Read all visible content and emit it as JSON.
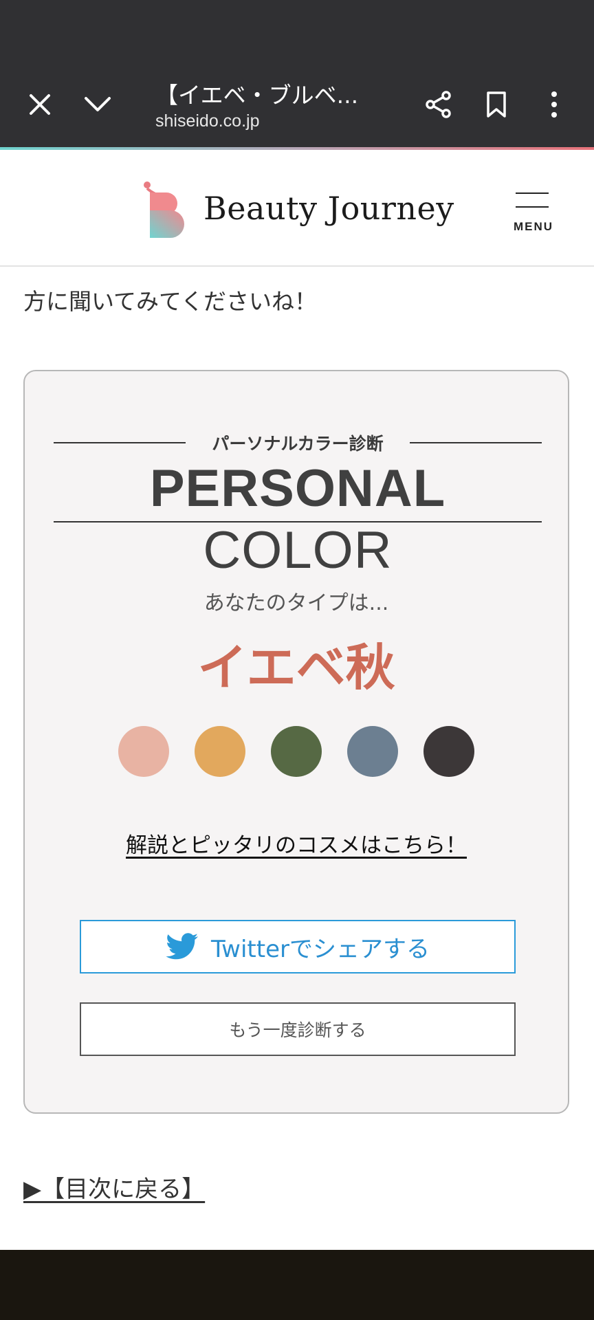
{
  "browser": {
    "tab_title": "【イエベ・ブルベ...",
    "url": "shiseido.co.jp"
  },
  "site": {
    "logo_text": "Beauty Journey",
    "menu_label": "MENU"
  },
  "article": {
    "lead_text": "方に聞いてみてくださいね！"
  },
  "card": {
    "kicker": "パーソナルカラー診断",
    "title_bold": "PERSONAL",
    "title_light": "COLOR",
    "type_intro": "あなたのタイプは...",
    "type_result": "イエベ秋",
    "swatches": [
      "#e8b3a3",
      "#e2a85d",
      "#566944",
      "#6c7f91",
      "#3c3738"
    ],
    "detail_link": "解説とピッタリのコスメはこちら！",
    "twitter_button": "Twitterでシェアする",
    "retry_button": "もう一度診断する"
  },
  "toc_link": "▶【目次に戻る】",
  "colors": {
    "accent_result": "#cd6b57",
    "twitter_blue": "#2a9ad9",
    "card_bg": "#f6f4f4"
  }
}
